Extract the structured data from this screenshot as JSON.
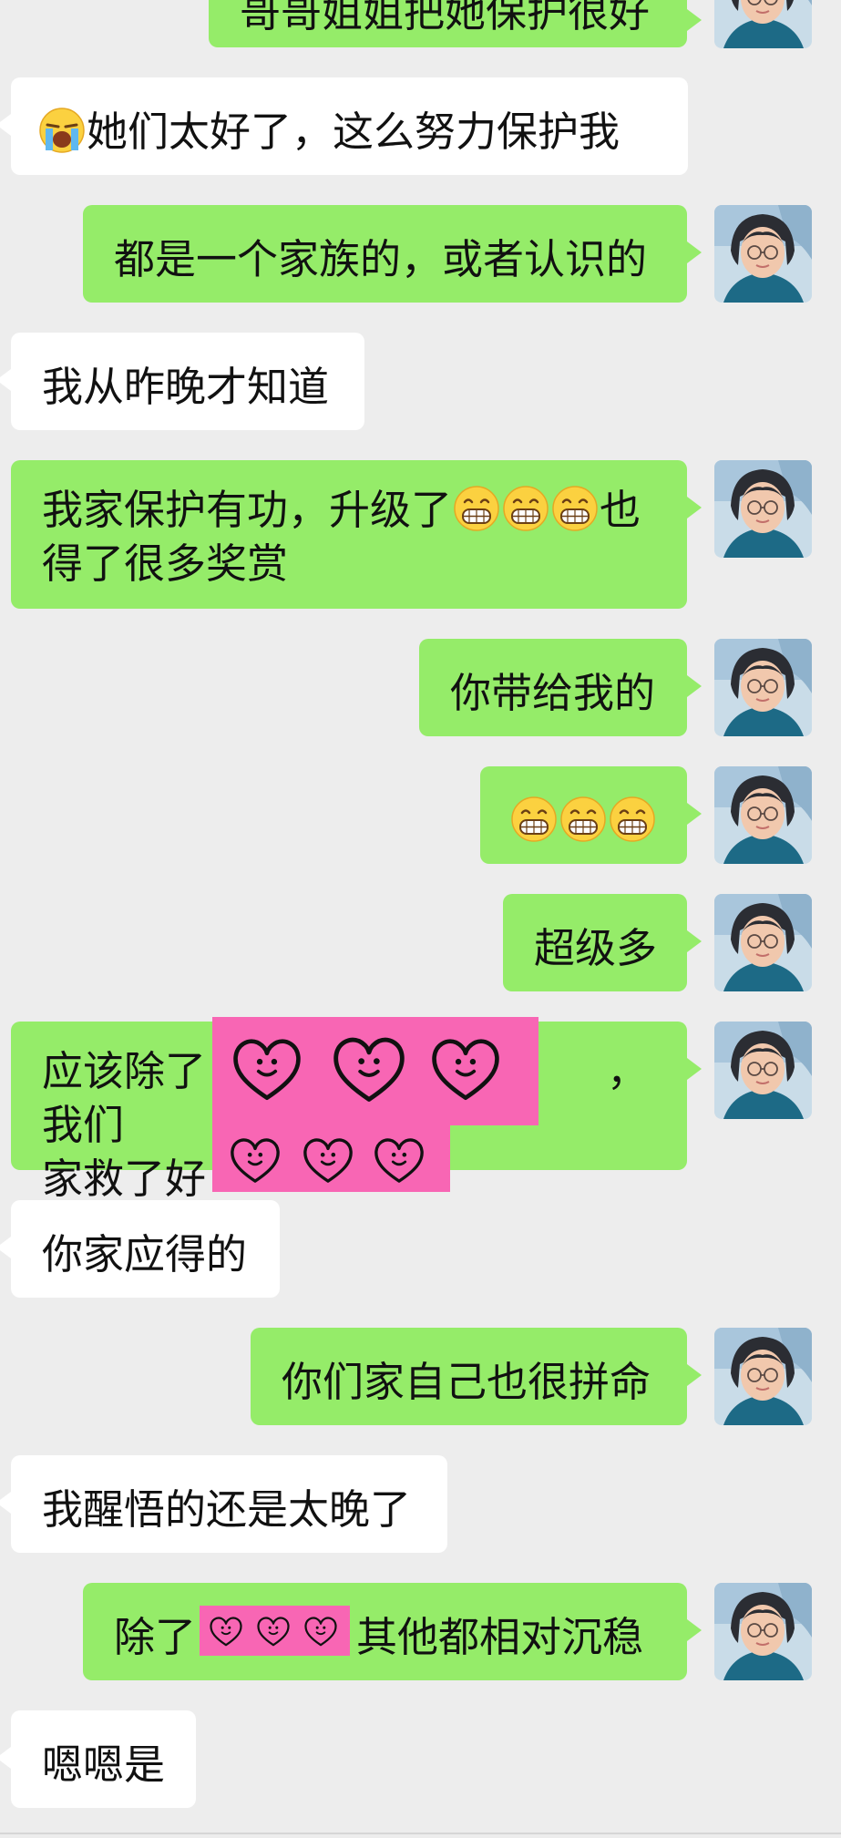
{
  "messages": [
    {
      "side": "me",
      "text": "哥哥姐姐把她保护很好"
    },
    {
      "side": "them",
      "emoji": "crying-emoji",
      "text": "她们太好了，这么努力保护我"
    },
    {
      "side": "me",
      "text": "都是一个家族的，或者认识的"
    },
    {
      "side": "them",
      "text": "我从昨晚才知道"
    },
    {
      "side": "me",
      "line1": "我家保护有功，升级了",
      "emoji": "grinning-emoji",
      "line1_end": "也",
      "line2": "得了很多奖赏"
    },
    {
      "side": "me",
      "text": "你带给我的"
    },
    {
      "side": "me",
      "emoji": "grinning-emoji",
      "emoji_count": 3
    },
    {
      "side": "me",
      "text": "超级多"
    },
    {
      "side": "me",
      "line1_start": "应该除了",
      "line1_end": "，我们",
      "line2_start": "家救了好",
      "redacted": true
    },
    {
      "side": "them",
      "text": "你家应得的"
    },
    {
      "side": "me",
      "text": "你们家自己也很拼命"
    },
    {
      "side": "them",
      "text": "我醒悟的还是太晚了"
    },
    {
      "side": "me",
      "text_start": "除了",
      "text_end": "其他都相对沉稳",
      "redacted": true
    },
    {
      "side": "them",
      "text": "嗯嗯是"
    }
  ],
  "colors": {
    "background": "#ededed",
    "my_bubble": "#95ec69",
    "their_bubble": "#ffffff",
    "redaction": "#f866b4"
  }
}
